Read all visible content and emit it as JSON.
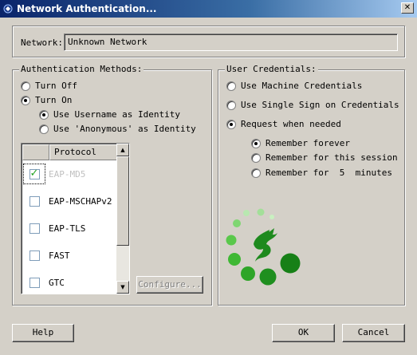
{
  "window": {
    "title": "Network Authentication...",
    "close_glyph": "✕",
    "icon": "shield-app-icon"
  },
  "network": {
    "label": "Network:",
    "value": "Unknown Network"
  },
  "auth_methods": {
    "legend": "Authentication Methods:",
    "turn_off": "Turn Off",
    "turn_on": "Turn On",
    "use_username": "Use Username as Identity",
    "use_anonymous": "Use 'Anonymous' as Identity",
    "selected_power": "Turn On",
    "selected_identity": "Use Username as Identity"
  },
  "protocol_list": {
    "header": "Protocol",
    "rows": [
      {
        "label": "EAP-MD5",
        "checked": true,
        "selected": true
      },
      {
        "label": "EAP-MSCHAPv2",
        "checked": false,
        "selected": false
      },
      {
        "label": "EAP-TLS",
        "checked": false,
        "selected": false
      },
      {
        "label": "FAST",
        "checked": false,
        "selected": false
      },
      {
        "label": "GTC",
        "checked": false,
        "selected": false
      }
    ]
  },
  "configure_button": "Configure...",
  "credentials": {
    "legend": "User Credentials:",
    "machine": "Use Machine Credentials",
    "sso": "Use Single Sign on Credentials",
    "request": "Request when needed",
    "remember_forever": "Remember forever",
    "remember_session": "Remember for this session",
    "remember_minutes": "Remember for  5  minutes",
    "selected_source": "Request when needed",
    "selected_remember": "Remember forever"
  },
  "logo": {
    "icon": "dragon-logo",
    "accent": "#1f8f1f"
  },
  "buttons": {
    "help": "Help",
    "ok": "OK",
    "cancel": "Cancel"
  }
}
